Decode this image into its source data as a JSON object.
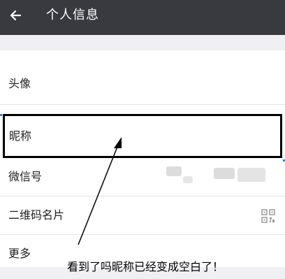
{
  "header": {
    "title": "个人信息",
    "back_icon": "arrow-left-icon",
    "background": "#393a3f"
  },
  "rows": [
    {
      "label": "头像"
    },
    {
      "label": "昵称"
    },
    {
      "label": "微信号",
      "value_obscured": true
    },
    {
      "label": "二维码名片",
      "icon": "qr-code-icon"
    },
    {
      "label": "更多"
    }
  ],
  "annotation": {
    "text": "看到了吗昵称已经变成空白了！",
    "highlight_color": "#000000"
  }
}
